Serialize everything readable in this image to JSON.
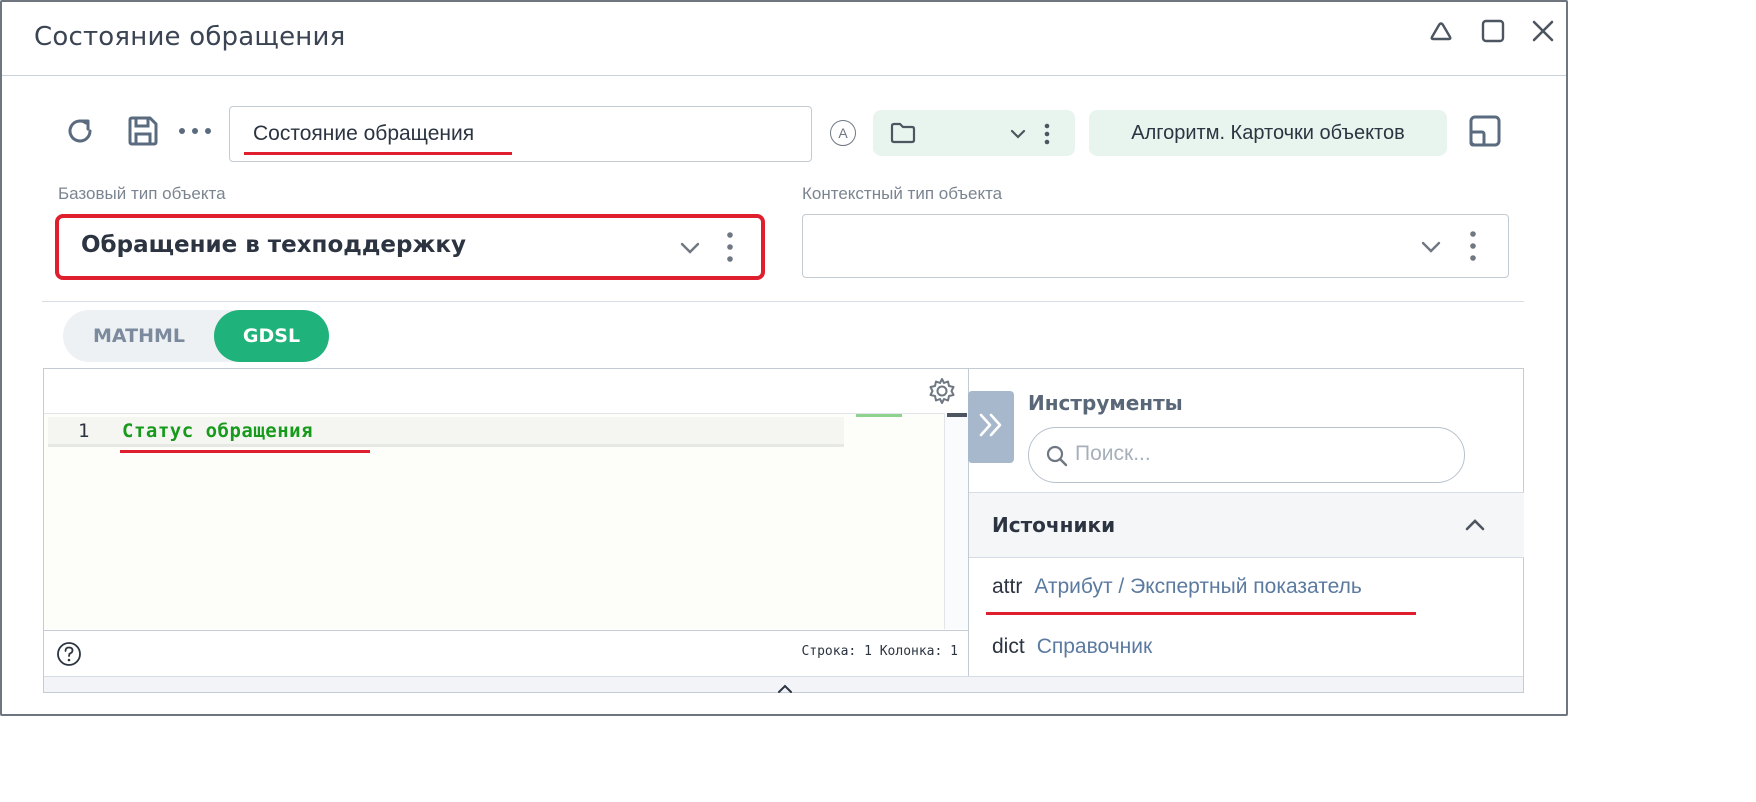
{
  "window": {
    "title": "Состояние обращения",
    "controls": [
      "collapse",
      "maximize",
      "close"
    ]
  },
  "toolbar": {
    "name_value": "Состояние обращения",
    "mode_badge": "A",
    "folder_value": "",
    "algorithm_label": "Алгоритм. Карточки объектов"
  },
  "fields": {
    "base_type_label": "Базовый тип объекта",
    "base_type_value": "Обращение в техподдержку",
    "context_type_label": "Контекстный тип объекта",
    "context_type_value": ""
  },
  "mode_tabs": {
    "items": [
      "MATHML",
      "GDSL"
    ],
    "active": "GDSL"
  },
  "editor": {
    "lines": [
      {
        "num": "1",
        "text": "Статус обращения"
      }
    ],
    "status": "Строка: 1 Колонка: 1"
  },
  "tools": {
    "title": "Инструменты",
    "search_placeholder": "Поиск...",
    "sources_title": "Источники",
    "sources": [
      {
        "key": "attr",
        "label": "Атрибут / Экспертный показатель"
      },
      {
        "key": "dict",
        "label": "Справочник"
      }
    ]
  },
  "colors": {
    "accent_green": "#1fb27a",
    "pill_bg": "#e8f5ef",
    "highlight_red": "#e01f2e",
    "code_green": "#189a1c",
    "link_blue": "#5b7aa0"
  }
}
